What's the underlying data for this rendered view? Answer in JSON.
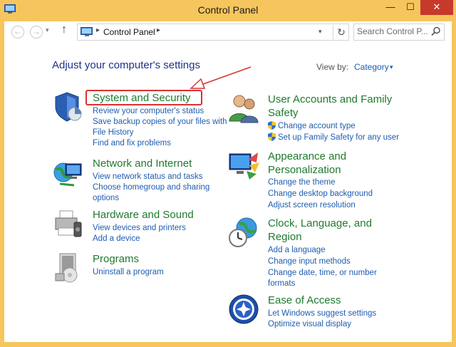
{
  "window": {
    "title": "Control Panel",
    "minimize_glyph": "—",
    "maximize_glyph": "☐",
    "close_glyph": "✕"
  },
  "toolbar": {
    "back_glyph": "←",
    "forward_glyph": "→",
    "recent_glyph": "▾",
    "up_glyph": "↑",
    "address_sep": "▸",
    "address": "Control Panel",
    "address_dropdown_glyph": "▾",
    "refresh_glyph": "↻",
    "search_placeholder": "Search Control P..."
  },
  "content": {
    "heading": "Adjust your computer's settings",
    "view_by_label": "View by:",
    "view_by_value": "Category",
    "view_by_arrow": "▾"
  },
  "categories": {
    "system_security": {
      "title": "System and Security",
      "links": [
        "Review your computer's status",
        "Save backup copies of your files with",
        "File History",
        "Find and fix problems"
      ]
    },
    "network": {
      "title": "Network and Internet",
      "links": [
        "View network status and tasks",
        "Choose homegroup and sharing",
        "options"
      ]
    },
    "hardware": {
      "title": "Hardware and Sound",
      "links": [
        "View devices and printers",
        "Add a device"
      ]
    },
    "programs": {
      "title": "Programs",
      "links": [
        "Uninstall a program"
      ]
    },
    "user_accounts": {
      "title_line1": "User Accounts and Family",
      "title_line2": "Safety",
      "links": [
        "Change account type",
        "Set up Family Safety for any user"
      ]
    },
    "appearance": {
      "title_line1": "Appearance and",
      "title_line2": "Personalization",
      "links": [
        "Change the theme",
        "Change desktop background",
        "Adjust screen resolution"
      ]
    },
    "clock": {
      "title_line1": "Clock, Language, and",
      "title_line2": "Region",
      "links": [
        "Add a language",
        "Change input methods",
        "Change date, time, or number",
        "formats"
      ]
    },
    "ease": {
      "title": "Ease of Access",
      "links": [
        "Let Windows suggest settings",
        "Optimize visual display"
      ]
    }
  },
  "icons": {
    "app": "control-panel-icon",
    "system_security": "shield-chart-icon",
    "network": "globe-network-icon",
    "hardware": "printer-icon",
    "programs": "program-box-icon",
    "user_accounts": "users-icon",
    "appearance": "monitor-paint-icon",
    "clock": "clock-globe-icon",
    "ease": "ease-of-access-icon"
  },
  "colors": {
    "title_bar": "#f6c55d",
    "close_button": "#c7392b",
    "category_title": "#1f7a2e",
    "link": "#1e5db0",
    "heading": "#1e3287",
    "annotation": "#d93232"
  }
}
